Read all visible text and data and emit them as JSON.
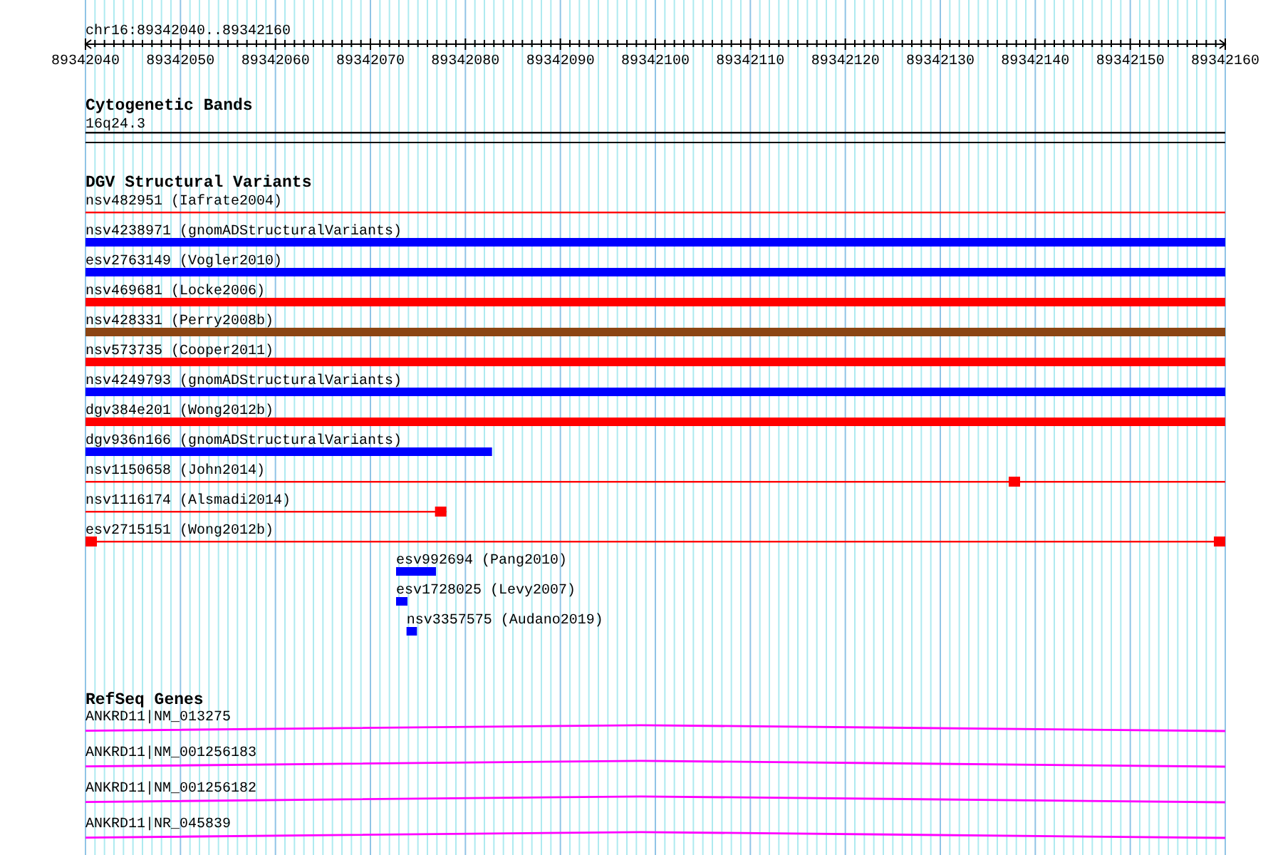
{
  "location": "chr16:89342040..89342160",
  "ruler": {
    "labels": [
      "89342040",
      "89342050",
      "89342060",
      "89342070",
      "89342080",
      "89342090",
      "89342100",
      "89342110",
      "89342120",
      "89342130",
      "89342140",
      "89342150",
      "89342160"
    ]
  },
  "tracks": [
    {
      "title": "Cytogenetic Bands",
      "kind": "bands",
      "features": [
        {
          "label": "16q24.3",
          "kind": "line",
          "color": "#000000"
        }
      ]
    },
    {
      "title": "DGV Structural Variants",
      "kind": "variants",
      "features": [
        {
          "label": "nsv482951 (Iafrate2004)",
          "kind": "line",
          "color": "#ff0000"
        },
        {
          "label": "nsv4238971 (gnomADStructuralVariants)",
          "kind": "bar",
          "color": "#0000ff"
        },
        {
          "label": "esv2763149 (Vogler2010)",
          "kind": "bar",
          "color": "#0000ff"
        },
        {
          "label": "nsv469681 (Locke2006)",
          "kind": "bar",
          "color": "#ff0000"
        },
        {
          "label": "nsv428331 (Perry2008b)",
          "kind": "bar",
          "color": "#8b4513"
        },
        {
          "label": "nsv573735 (Cooper2011)",
          "kind": "bar",
          "color": "#ff0000"
        },
        {
          "label": "nsv4249793 (gnomADStructuralVariants)",
          "kind": "bar",
          "color": "#0000ff"
        },
        {
          "label": "dgv384e201 (Wong2012b)",
          "kind": "bar",
          "color": "#ff0000"
        },
        {
          "label": "dgv936n166 (gnomADStructuralVariants)",
          "kind": "bar",
          "color": "#0000ff"
        },
        {
          "label": "nsv1150658 (John2014)",
          "kind": "line",
          "color": "#ff0000"
        },
        {
          "label": "nsv1116174 (Alsmadi2014)",
          "kind": "line",
          "color": "#ff0000"
        },
        {
          "label": "esv2715151 (Wong2012b)",
          "kind": "line",
          "color": "#ff0000"
        },
        {
          "label": "esv992694 (Pang2010)",
          "kind": "bar",
          "color": "#0000ff"
        },
        {
          "label": "esv1728025 (Levy2007)",
          "kind": "bar",
          "color": "#0000ff"
        },
        {
          "label": "nsv3357575 (Audano2019)",
          "kind": "bar",
          "color": "#0000ff"
        }
      ]
    },
    {
      "title": "RefSeq Genes",
      "kind": "genes",
      "features": [
        {
          "label": "ANKRD11|NM_013275",
          "kind": "transcript"
        },
        {
          "label": "ANKRD11|NM_001256183",
          "kind": "transcript"
        },
        {
          "label": "ANKRD11|NM_001256182",
          "kind": "transcript"
        },
        {
          "label": "ANKRD11|NR_045839",
          "kind": "transcript"
        }
      ]
    }
  ]
}
